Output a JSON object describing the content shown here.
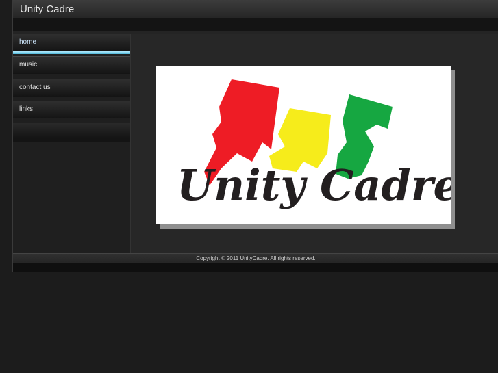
{
  "header": {
    "site_title": "Unity Cadre"
  },
  "nav": {
    "items": [
      {
        "label": "home",
        "active": true
      },
      {
        "label": "music",
        "active": false
      },
      {
        "label": "contact us",
        "active": false
      },
      {
        "label": "links",
        "active": false
      }
    ]
  },
  "main": {
    "logo": {
      "wordmark": "Unity Cadre",
      "colors": {
        "red": "#ee1c25",
        "yellow": "#f6ec1b",
        "green": "#16a741",
        "ink": "#231f20"
      }
    }
  },
  "footer": {
    "copyright": "Copyright © 2011 UnityCadre. All rights reserved."
  },
  "theme": {
    "accent": "#6cc8e6",
    "background": "#1c1c1c"
  }
}
